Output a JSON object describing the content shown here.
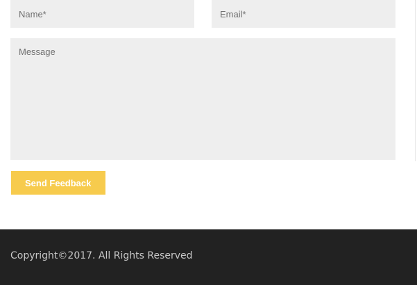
{
  "contact_form": {
    "name_placeholder": "Name*",
    "email_placeholder": "Email*",
    "message_placeholder": "Message",
    "submit_label": "Send Feedback"
  },
  "footer": {
    "copyright": "Copyright©2017. All Rights Reserved"
  },
  "colors": {
    "button_accent": "#f7cb4d",
    "field_background": "#eeeeee",
    "footer_background": "#222222"
  }
}
